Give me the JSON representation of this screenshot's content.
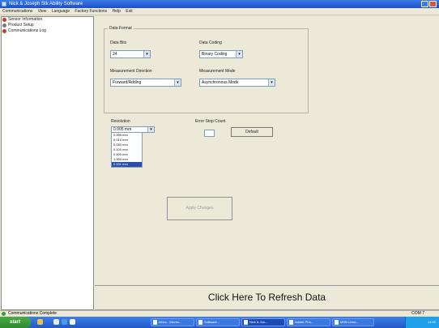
{
  "window": {
    "title": "Nick & Joseph Stk Ability Software"
  },
  "menu": [
    "Communications",
    "View",
    "Language",
    "Factory Functions",
    "Help",
    "Exit"
  ],
  "tree": [
    {
      "label": "Sensor Information",
      "color": "#c93a2a"
    },
    {
      "label": "Product Setup",
      "color": "#7a7a7a"
    },
    {
      "label": "Communications Log",
      "color": "#c93a2a"
    }
  ],
  "data_format": {
    "title": "Data Format",
    "data_bits_label": "Data Bits",
    "data_bits_value": "24",
    "data_coding_label": "Data Coding",
    "data_coding_value": "Binary Coding",
    "measurement_direction_label": "Measurement Direction",
    "measurement_direction_value": "Forward/Adding",
    "measurement_mode_label": "Measurement Mode",
    "measurement_mode_value": "Asynchronous Mode"
  },
  "resolution": {
    "label": "Resolution",
    "selected": "0.005 mm",
    "options": [
      "0.005 mm",
      "0.010 mm",
      "0.050 mm",
      "0.100 mm",
      "0.500 mm",
      "1.000 mm",
      "0.001 mm"
    ],
    "selected_index": 6
  },
  "error_stop": {
    "label": "Error Stop Count",
    "default_button": "Default"
  },
  "apply_button": "Apply Changes",
  "refresh_label": "Click Here To Refresh Data",
  "status": {
    "text": "Communications Complete",
    "right": "COM 7"
  },
  "taskbar": {
    "start": "start",
    "tasks": [
      "Inbox - Micros...",
      "Software...",
      "Nick & Jos...",
      "Adobe Pho...",
      "MSN Linke..."
    ],
    "clock": "12:00"
  }
}
